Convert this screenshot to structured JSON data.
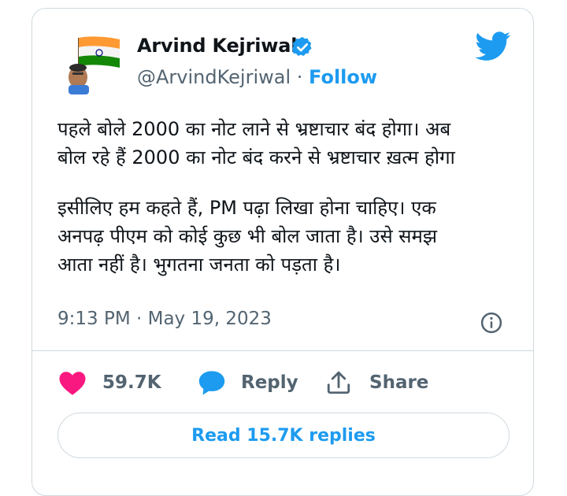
{
  "author": {
    "name": "Arvind Kejriwal",
    "handle": "@ArvindKejriwal",
    "separator": "·",
    "follow_label": "Follow"
  },
  "tweet": {
    "paragraph1": [
      "पहले बोले 2000 का नोट लाने से भ्रष्टाचार बंद होगा। अब",
      "बोल रहे हैं 2000 का नोट बंद करने से भ्रष्टाचार ख़त्म होगा"
    ],
    "paragraph2": [
      "इसीलिए हम कहते हैं, PM पढ़ा लिखा होना चाहिए। एक",
      "अनपढ़ पीएम को कोई कुछ भी बोल जाता है। उसे समझ",
      "आता नहीं है। भुगतना जनता को पड़ता है।"
    ],
    "timestamp": "9:13 PM · May 19, 2023"
  },
  "actions": {
    "likes": "59.7K",
    "reply_label": "Reply",
    "share_label": "Share"
  },
  "read_replies_label": "Read 15.7K replies",
  "colors": {
    "accent": "#1d9bf0",
    "like_heart": "#f91880",
    "muted_text": "#536471",
    "border": "#cfd9de"
  },
  "icons": [
    "verified-badge-icon",
    "twitter-bird-icon",
    "info-icon",
    "heart-icon",
    "reply-bubble-icon",
    "share-icon"
  ]
}
